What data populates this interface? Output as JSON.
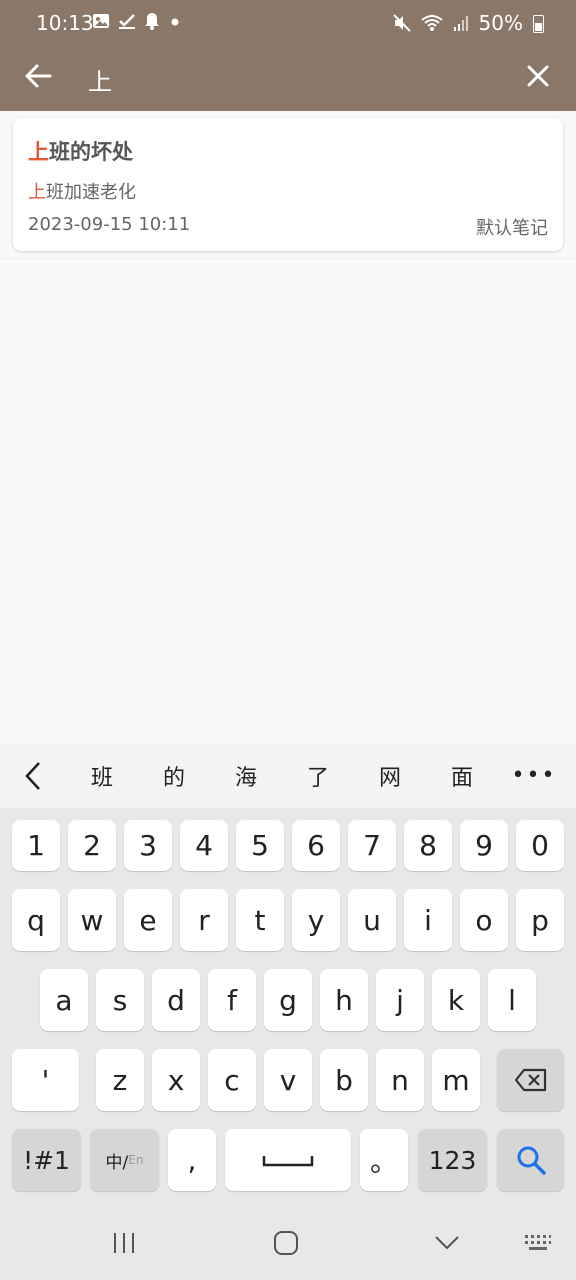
{
  "status_bar": {
    "time": "10:13",
    "battery": "50%",
    "icons": [
      "gallery-icon",
      "task-check-icon",
      "notification-bell-icon",
      "dot-icon",
      "mute-icon",
      "wifi-icon",
      "signal-icon",
      "battery-icon"
    ]
  },
  "search": {
    "query": "上"
  },
  "results": [
    {
      "title_highlight": "上",
      "title_rest": "班的坏处",
      "snippet_highlight": "上",
      "snippet_rest": "班加速老化",
      "date": "2023-09-15 10:11",
      "notebook": "默认笔记"
    }
  ],
  "candidates": [
    "班",
    "的",
    "海",
    "了",
    "网",
    "面"
  ],
  "candidates_more": "•••",
  "keyboard": {
    "row_numbers": [
      "1",
      "2",
      "3",
      "4",
      "5",
      "6",
      "7",
      "8",
      "9",
      "0"
    ],
    "row_1": [
      "q",
      "w",
      "e",
      "r",
      "t",
      "y",
      "u",
      "i",
      "o",
      "p"
    ],
    "row_2": [
      "a",
      "s",
      "d",
      "f",
      "g",
      "h",
      "j",
      "k",
      "l"
    ],
    "row_3": [
      "'",
      "z",
      "x",
      "c",
      "v",
      "b",
      "n",
      "m"
    ],
    "symbols_key": "!#1",
    "lang_key_main": "中/",
    "lang_key_sub": "En",
    "comma_key": ",",
    "period_key": "。",
    "num_key": "123"
  },
  "colors": {
    "header": "#8a7767",
    "highlight": "#e05a39",
    "search_key": "#1a73e8"
  }
}
